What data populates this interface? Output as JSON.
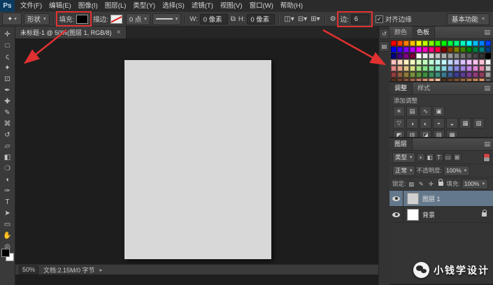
{
  "menu_bar": {
    "logo": "Ps",
    "items": [
      "文件(F)",
      "编辑(E)",
      "图像(I)",
      "图层(L)",
      "类型(Y)",
      "选择(S)",
      "滤镜(T)",
      "视图(V)",
      "窗口(W)",
      "帮助(H)"
    ]
  },
  "options_bar": {
    "tool_mode": "形状",
    "fill": {
      "label": "填充:"
    },
    "stroke": {
      "label": "描边:",
      "width": "0 点"
    },
    "w": {
      "label": "W:",
      "value": "0 像素"
    },
    "h": {
      "label": "H:",
      "value": "0 像素"
    },
    "sides": {
      "label": "边:",
      "value": "6"
    },
    "align_edges_label": "对齐边缘",
    "workspace": "基本功能"
  },
  "document_tab": {
    "title": "未标题-1 @ 50%(图层 1, RGB/8)",
    "close": "×"
  },
  "status_bar": {
    "zoom": "50%",
    "doc_info": "文档:2.15M/0 字节"
  },
  "annotation_color": "#e03131",
  "tools": [
    {
      "name": "move",
      "glyph": "✛"
    },
    {
      "name": "rectangular-marquee",
      "glyph": "□"
    },
    {
      "name": "lasso",
      "glyph": "ς"
    },
    {
      "name": "quick-selection",
      "glyph": "✦"
    },
    {
      "name": "crop",
      "glyph": "⊡"
    },
    {
      "name": "eyedropper",
      "glyph": "✒"
    },
    {
      "name": "spot-healing-brush",
      "glyph": "✚"
    },
    {
      "name": "brush",
      "glyph": "✎"
    },
    {
      "name": "clone-stamp",
      "glyph": "⌘"
    },
    {
      "name": "history-brush",
      "glyph": "↺"
    },
    {
      "name": "eraser",
      "glyph": "▱"
    },
    {
      "name": "gradient",
      "glyph": "◧"
    },
    {
      "name": "blur",
      "glyph": "❍"
    },
    {
      "name": "dodge",
      "glyph": "◖"
    },
    {
      "name": "pen",
      "glyph": "✑"
    },
    {
      "name": "type",
      "glyph": "T"
    },
    {
      "name": "path-selection",
      "glyph": "➤"
    },
    {
      "name": "rectangle-shape",
      "glyph": "▭"
    },
    {
      "name": "hand",
      "glyph": "✋"
    },
    {
      "name": "zoom",
      "glyph": "◎"
    }
  ],
  "dock": {
    "icons": [
      {
        "name": "collapsed-history-panel",
        "glyph": "↺"
      },
      {
        "name": "collapsed-properties-panel",
        "glyph": "▤"
      }
    ]
  },
  "panels": {
    "swatches_panel": {
      "tabs": [
        "颜色",
        "色板"
      ],
      "active_tab": "色板",
      "colors": [
        "#ff0000",
        "#ff4000",
        "#ff8000",
        "#ffbf00",
        "#ffff00",
        "#bfff00",
        "#80ff00",
        "#40ff00",
        "#00ff00",
        "#00ff40",
        "#00ff80",
        "#00ffbf",
        "#00ffff",
        "#00bfff",
        "#0080ff",
        "#0040ff",
        "#0000ff",
        "#4000ff",
        "#8000ff",
        "#bf00ff",
        "#ff00ff",
        "#ff00bf",
        "#ff0080",
        "#ff0040",
        "#800000",
        "#804000",
        "#808000",
        "#408000",
        "#008000",
        "#008040",
        "#008080",
        "#004080",
        "#000080",
        "#400080",
        "#800080",
        "#800040",
        "#ffffff",
        "#ebebeb",
        "#d6d6d6",
        "#c2c2c2",
        "#adadad",
        "#999999",
        "#858585",
        "#707070",
        "#5c5c5c",
        "#474747",
        "#333333",
        "#000000",
        "#ffc2c2",
        "#ffd9c2",
        "#fff0c2",
        "#f5ffc2",
        "#d9ffc2",
        "#c2ffc2",
        "#c2ffd9",
        "#c2fff0",
        "#c2f5ff",
        "#c2d9ff",
        "#c2c2ff",
        "#d9c2ff",
        "#f0c2ff",
        "#ffc2f0",
        "#ffc2d9",
        "#f0f0f0",
        "#e08585",
        "#e0a385",
        "#e0c285",
        "#d6e085",
        "#a3e085",
        "#85e085",
        "#85e0a3",
        "#85e0c2",
        "#85d6e0",
        "#85a3e0",
        "#8585e0",
        "#a385e0",
        "#c285e0",
        "#e085d6",
        "#e085a3",
        "#cccccc",
        "#8f3d3d",
        "#8f5c3d",
        "#8f7a3d",
        "#7a8f3d",
        "#5c8f3d",
        "#3d8f3d",
        "#3d8f5c",
        "#3d8f7a",
        "#3d7a8f",
        "#3d5c8f",
        "#3d3d8f",
        "#5c3d8f",
        "#7a3d8f",
        "#8f3d7a",
        "#8f3d5c",
        "#999999",
        "#5c2e1f",
        "#73402e",
        "#8a523d",
        "#a3664d",
        "#bf7a5c",
        "#d6916e",
        "#e8a885",
        "#f5bf9e",
        "#4d3319",
        "#664426",
        "#805533",
        "#996640",
        "#b2774d",
        "#cc8859",
        "#e59966",
        "#666666"
      ]
    },
    "adjustments_panel": {
      "tabs": [
        "调整",
        "样式"
      ],
      "title": "添加调整",
      "icon_rows": [
        [
          {
            "name": "brightness-contrast",
            "glyph": "☀"
          },
          {
            "name": "levels",
            "glyph": "▤"
          },
          {
            "name": "curves",
            "glyph": "∿"
          },
          {
            "name": "exposure",
            "glyph": "▣"
          }
        ],
        [
          {
            "name": "vibrance",
            "glyph": "▽"
          },
          {
            "name": "hue-saturation",
            "glyph": "◑"
          },
          {
            "name": "color-balance",
            "glyph": "◐"
          },
          {
            "name": "black-white",
            "glyph": "◓"
          },
          {
            "name": "photo-filter",
            "glyph": "◒"
          },
          {
            "name": "channel-mixer",
            "glyph": "▦"
          },
          {
            "name": "color-lookup",
            "glyph": "▧"
          }
        ],
        [
          {
            "name": "invert",
            "glyph": "◩"
          },
          {
            "name": "posterize",
            "glyph": "▥"
          },
          {
            "name": "threshold",
            "glyph": "◪"
          },
          {
            "name": "gradient-map",
            "glyph": "▨"
          },
          {
            "name": "selective-color",
            "glyph": "▩"
          }
        ]
      ]
    },
    "layers_panel": {
      "tab": "图层",
      "filter": {
        "kind_label": "类型",
        "icons": [
          {
            "name": "filter-pixel-layers",
            "glyph": "▪"
          },
          {
            "name": "filter-adjustment-layers",
            "glyph": "◧"
          },
          {
            "name": "filter-type-layers",
            "glyph": "T"
          },
          {
            "name": "filter-shape-layers",
            "glyph": "▭"
          },
          {
            "name": "filter-smart-objects",
            "glyph": "⊞"
          }
        ]
      },
      "blend_mode": "正常",
      "opacity_label": "不透明度:",
      "opacity_value": "100%",
      "lock_label": "锁定:",
      "fill_label": "填充:",
      "fill_value": "100%",
      "layers": [
        {
          "name": "图层 1",
          "selected": true,
          "thumb": "#d0d0d0",
          "locked": false
        },
        {
          "name": "背景",
          "selected": false,
          "thumb": "#ffffff",
          "locked": true
        }
      ]
    }
  },
  "watermark": {
    "text": "小钱学设计"
  }
}
